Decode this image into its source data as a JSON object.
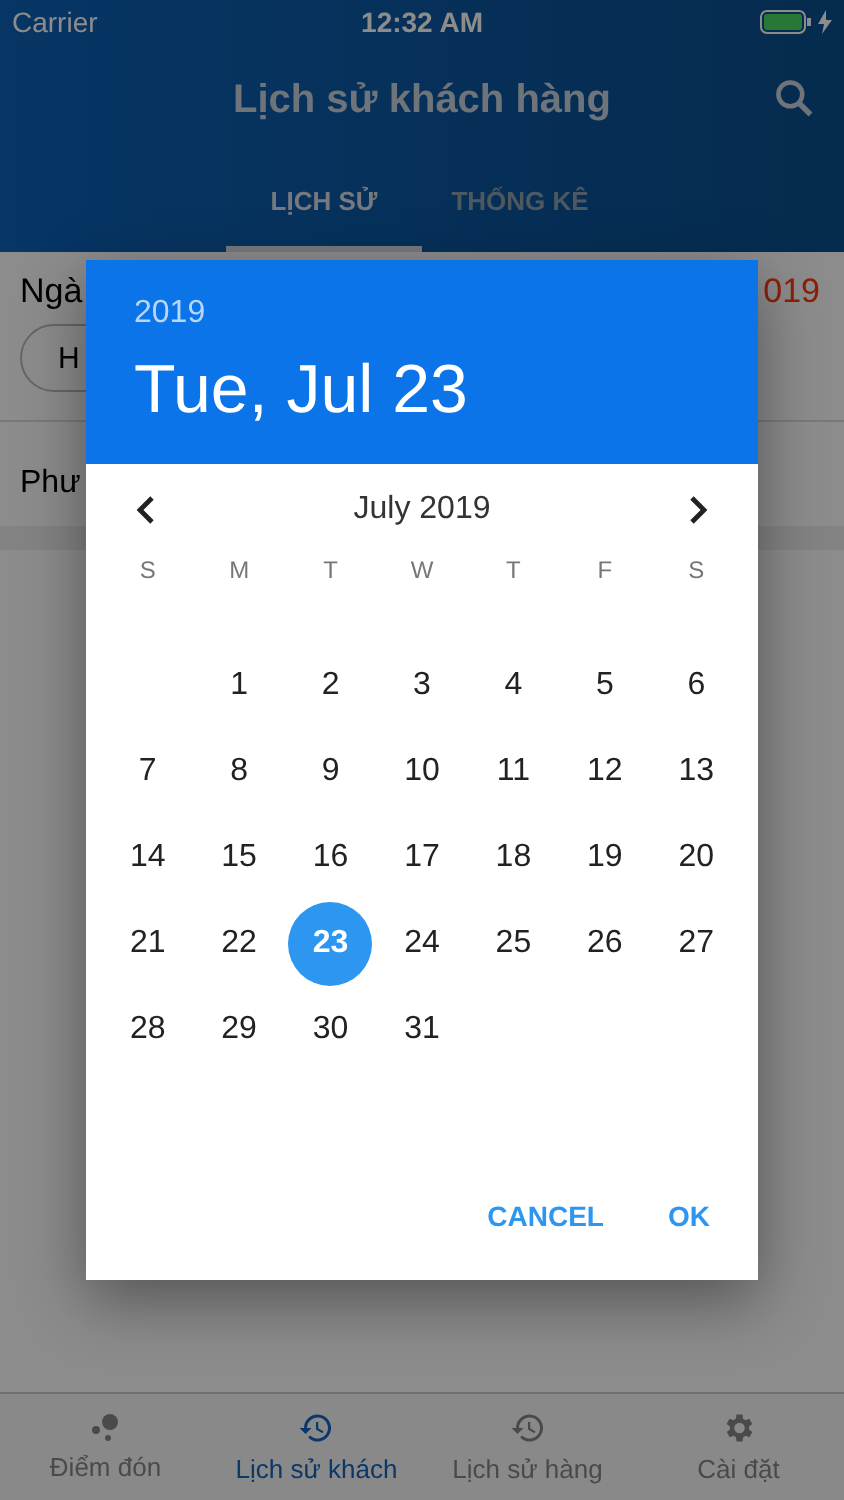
{
  "status_bar": {
    "carrier": "Carrier",
    "time": "12:32 AM"
  },
  "header": {
    "title": "Lịch sử khách hàng"
  },
  "tabs": [
    {
      "label": "LỊCH SỬ",
      "selected": true
    },
    {
      "label": "THỐNG KÊ",
      "selected": false
    }
  ],
  "content": {
    "date_label": "Ngà",
    "date_value": "019",
    "chip": "H",
    "method_label": "Phư"
  },
  "date_picker": {
    "year": "2019",
    "date": "Tue, Jul 23",
    "month": "July 2019",
    "weekdays": [
      "S",
      "M",
      "T",
      "W",
      "T",
      "F",
      "S"
    ],
    "weeks": [
      {
        "kind": "start",
        "days": [
          {
            "day": "1",
            "selected": false
          },
          {
            "day": "2",
            "selected": false
          },
          {
            "day": "3",
            "selected": false
          },
          {
            "day": "4",
            "selected": false
          },
          {
            "day": "5",
            "selected": false
          },
          {
            "day": "6",
            "selected": false
          }
        ]
      },
      {
        "kind": "full",
        "days": [
          {
            "day": "7",
            "selected": false
          },
          {
            "day": "8",
            "selected": false
          },
          {
            "day": "9",
            "selected": false
          },
          {
            "day": "10",
            "selected": false
          },
          {
            "day": "11",
            "selected": false
          },
          {
            "day": "12",
            "selected": false
          },
          {
            "day": "13",
            "selected": false
          }
        ]
      },
      {
        "kind": "full",
        "days": [
          {
            "day": "14",
            "selected": false
          },
          {
            "day": "15",
            "selected": false
          },
          {
            "day": "16",
            "selected": false
          },
          {
            "day": "17",
            "selected": false
          },
          {
            "day": "18",
            "selected": false
          },
          {
            "day": "19",
            "selected": false
          },
          {
            "day": "20",
            "selected": false
          }
        ]
      },
      {
        "kind": "full",
        "days": [
          {
            "day": "21",
            "selected": false
          },
          {
            "day": "22",
            "selected": false
          },
          {
            "day": "23",
            "selected": true
          },
          {
            "day": "24",
            "selected": false
          },
          {
            "day": "25",
            "selected": false
          },
          {
            "day": "26",
            "selected": false
          },
          {
            "day": "27",
            "selected": false
          }
        ]
      },
      {
        "kind": "end",
        "days": [
          {
            "day": "28",
            "selected": false
          },
          {
            "day": "29",
            "selected": false
          },
          {
            "day": "30",
            "selected": false
          },
          {
            "day": "31",
            "selected": false
          }
        ]
      }
    ],
    "buttons": [
      "CANCEL",
      "OK"
    ]
  },
  "bottom_nav": [
    {
      "label": "Điểm đón",
      "kind": "dots",
      "selected": false
    },
    {
      "label": "Lịch sử khách",
      "kind": "history",
      "selected": true
    },
    {
      "label": "Lịch sử hàng",
      "kind": "history",
      "selected": false
    },
    {
      "label": "Cài đặt",
      "kind": "gear",
      "selected": false
    }
  ]
}
